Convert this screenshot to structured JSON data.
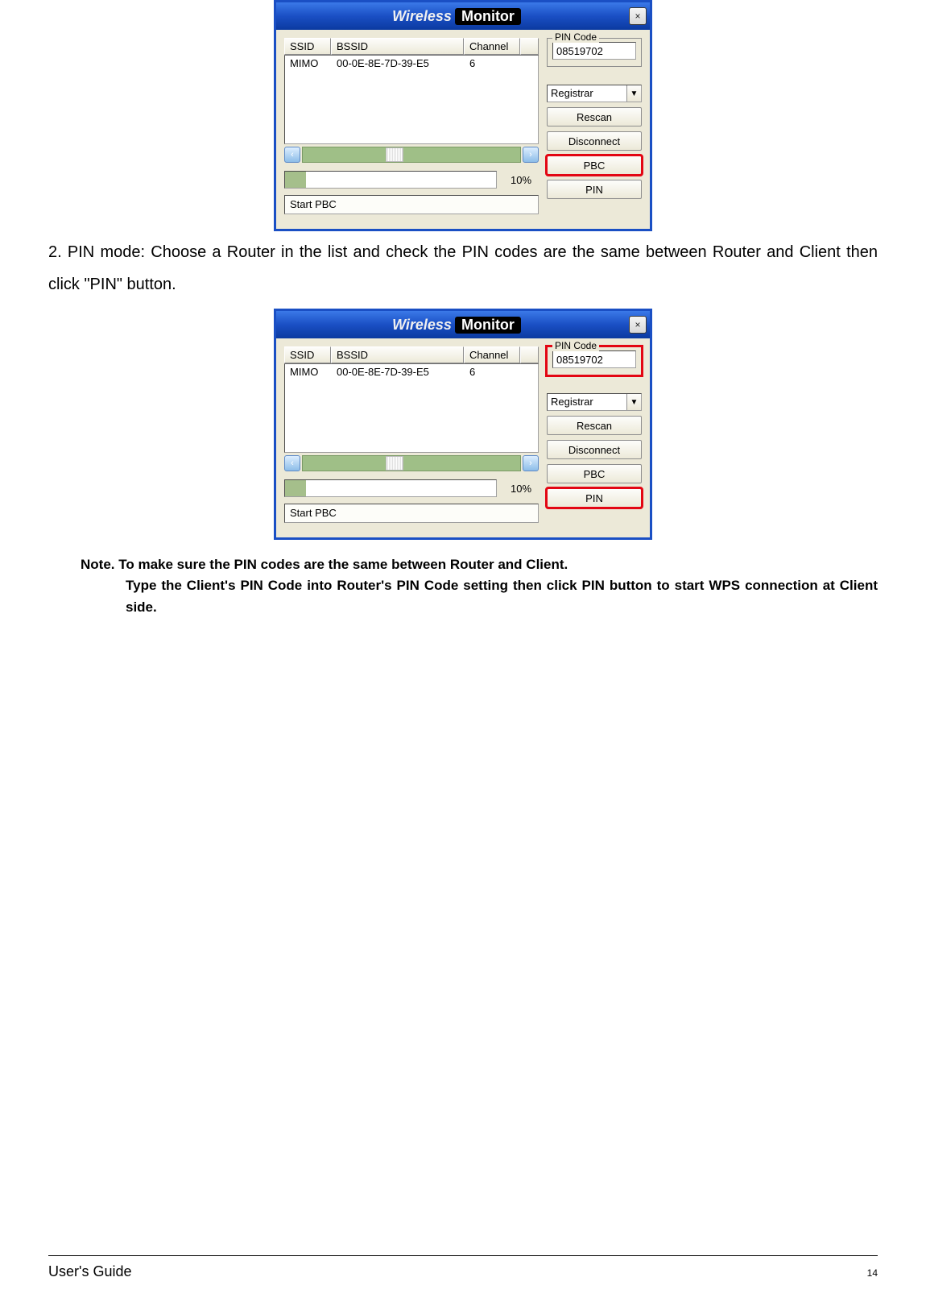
{
  "dialog_common": {
    "title_w1": "Wireless",
    "title_w2": "Monitor",
    "close_glyph": "×",
    "columns": {
      "ssid": "SSID",
      "bssid": "BSSID",
      "channel": "Channel"
    },
    "row": {
      "ssid": "MIMO",
      "bssid": "00-0E-8E-7D-39-E5",
      "channel": "6"
    },
    "progress": "10%",
    "status": "Start PBC",
    "pin_legend": "PIN Code",
    "pin_value": "08519702",
    "combo": "Registrar",
    "combo_arrow": "▼",
    "buttons": {
      "rescan": "Rescan",
      "disconnect": "Disconnect",
      "pbc": "PBC",
      "pin": "PIN"
    },
    "scroll_left": "‹",
    "scroll_right": "›"
  },
  "text": {
    "p2": "2. PIN mode: Choose a Router in the list and check the PIN codes are the same between Router and Client then click \"PIN\" button.",
    "note1": "Note. To make sure the PIN codes are the same between Router and Client.",
    "note2": "Type the Client's PIN Code into Router's PIN Code setting then click PIN button to start WPS connection at Client side."
  },
  "footer": {
    "left": "User's Guide",
    "page": "14"
  }
}
